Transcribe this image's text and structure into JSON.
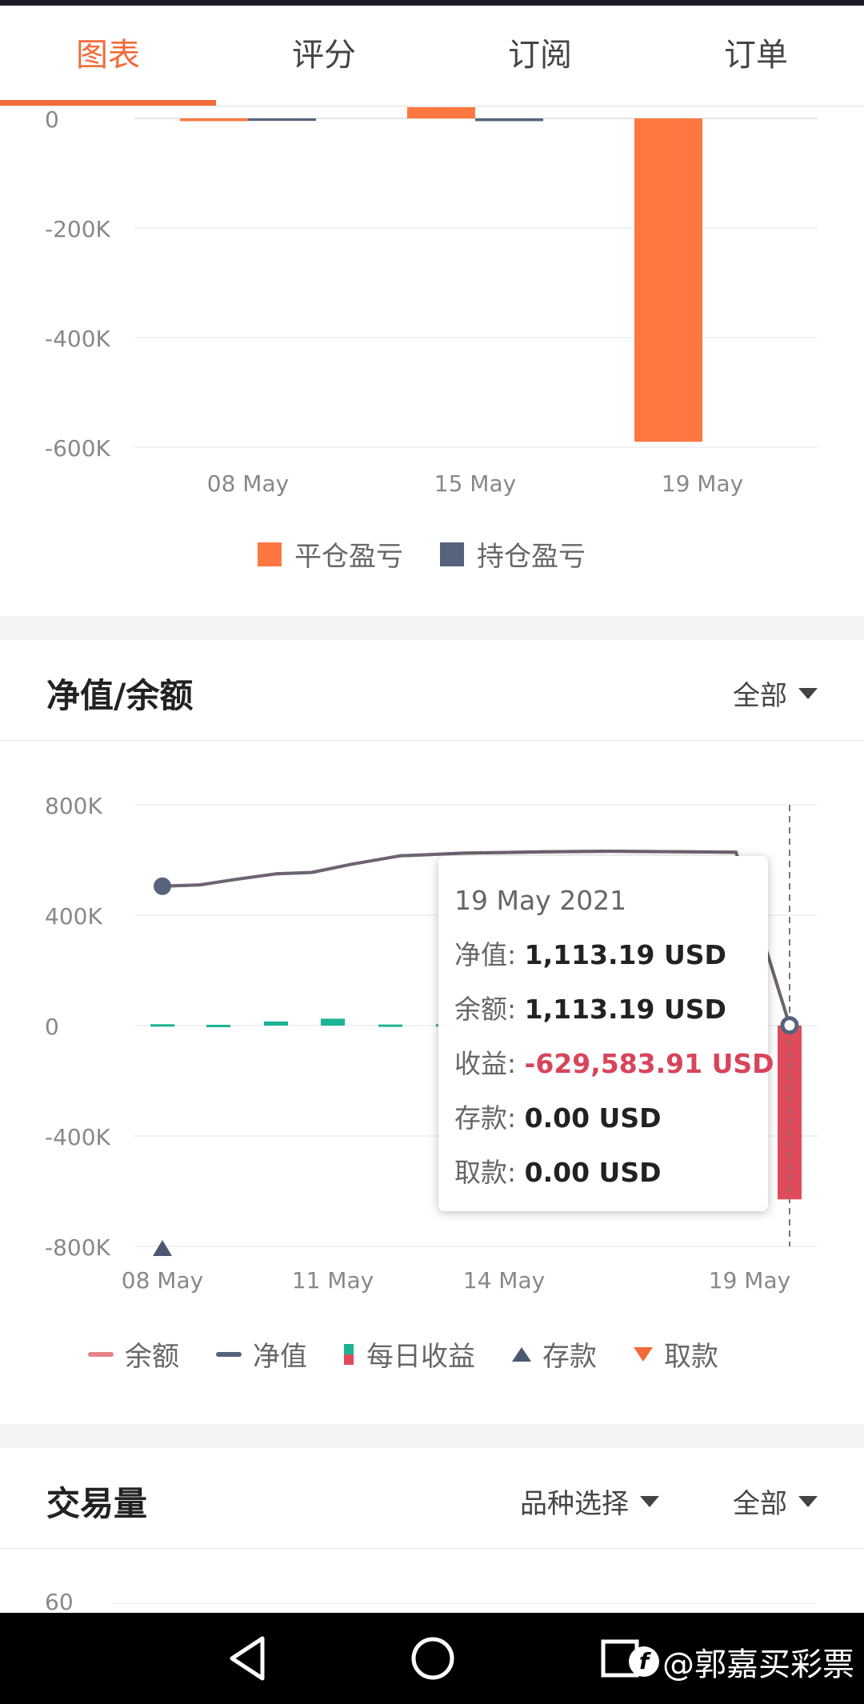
{
  "tabs": [
    {
      "label": "图表",
      "active": true
    },
    {
      "label": "评分",
      "active": false
    },
    {
      "label": "订阅",
      "active": false
    },
    {
      "label": "订单",
      "active": false
    }
  ],
  "pnl_chart": {
    "chart_data": {
      "type": "bar",
      "categories": [
        "08 May",
        "15 May",
        "19 May"
      ],
      "y_ticks": [
        "0",
        "-200K",
        "-400K",
        "-600K"
      ],
      "ylim": [
        -600000,
        0
      ],
      "series": [
        {
          "name": "平仓盈亏",
          "color": "#ff7740",
          "values": [
            -5000,
            25000,
            -590000
          ]
        },
        {
          "name": "持仓盈亏",
          "color": "#55637c",
          "values": [
            -2000,
            -5000,
            0
          ]
        }
      ],
      "legend_position": "bottom-center"
    }
  },
  "equity_section": {
    "title": "净值/余额",
    "filter_label": "全部",
    "chart_data": {
      "type": "line",
      "x_ticks": [
        "08 May",
        "11 May",
        "14 May",
        "19 May"
      ],
      "y_ticks": [
        "800K",
        "400K",
        "0",
        "-400K",
        "-800K"
      ],
      "ylim": [
        -800000,
        800000
      ],
      "equity": [
        505000,
        510000,
        530000,
        550000,
        555000,
        585000,
        615000,
        625000,
        630000,
        632000,
        628000,
        1113.19
      ],
      "daily_profit": [
        5000,
        3000,
        15000,
        25000,
        4000,
        5000,
        -629583.91
      ],
      "legend": [
        {
          "label": "余额",
          "color": "#e8838c",
          "kind": "dash"
        },
        {
          "label": "净值",
          "color": "#55637c",
          "kind": "dash"
        },
        {
          "label": "每日收益",
          "color_top": "#1bb394",
          "color_bottom": "#e04b5b",
          "kind": "split"
        },
        {
          "label": "存款",
          "color": "#4b5870",
          "kind": "tri-up"
        },
        {
          "label": "取款",
          "color": "#f26b3a",
          "kind": "tri-down"
        }
      ]
    },
    "tooltip": {
      "date": "19 May 2021",
      "rows": [
        {
          "label": "净值:",
          "value": "1,113.19 USD",
          "negative": false
        },
        {
          "label": "余额:",
          "value": "1,113.19 USD",
          "negative": false
        },
        {
          "label": "收益:",
          "value": "-629,583.91 USD",
          "negative": true
        },
        {
          "label": "存款:",
          "value": "0.00 USD",
          "negative": false
        },
        {
          "label": "取款:",
          "value": "0.00 USD",
          "negative": false
        }
      ]
    }
  },
  "volume_section": {
    "title": "交易量",
    "symbol_filter_label": "品种选择",
    "filter_label": "全部",
    "y_top_tick": "60"
  },
  "navbar": {
    "watermark": "@郭嘉买彩票",
    "watermark_icon_glyph": "f"
  }
}
